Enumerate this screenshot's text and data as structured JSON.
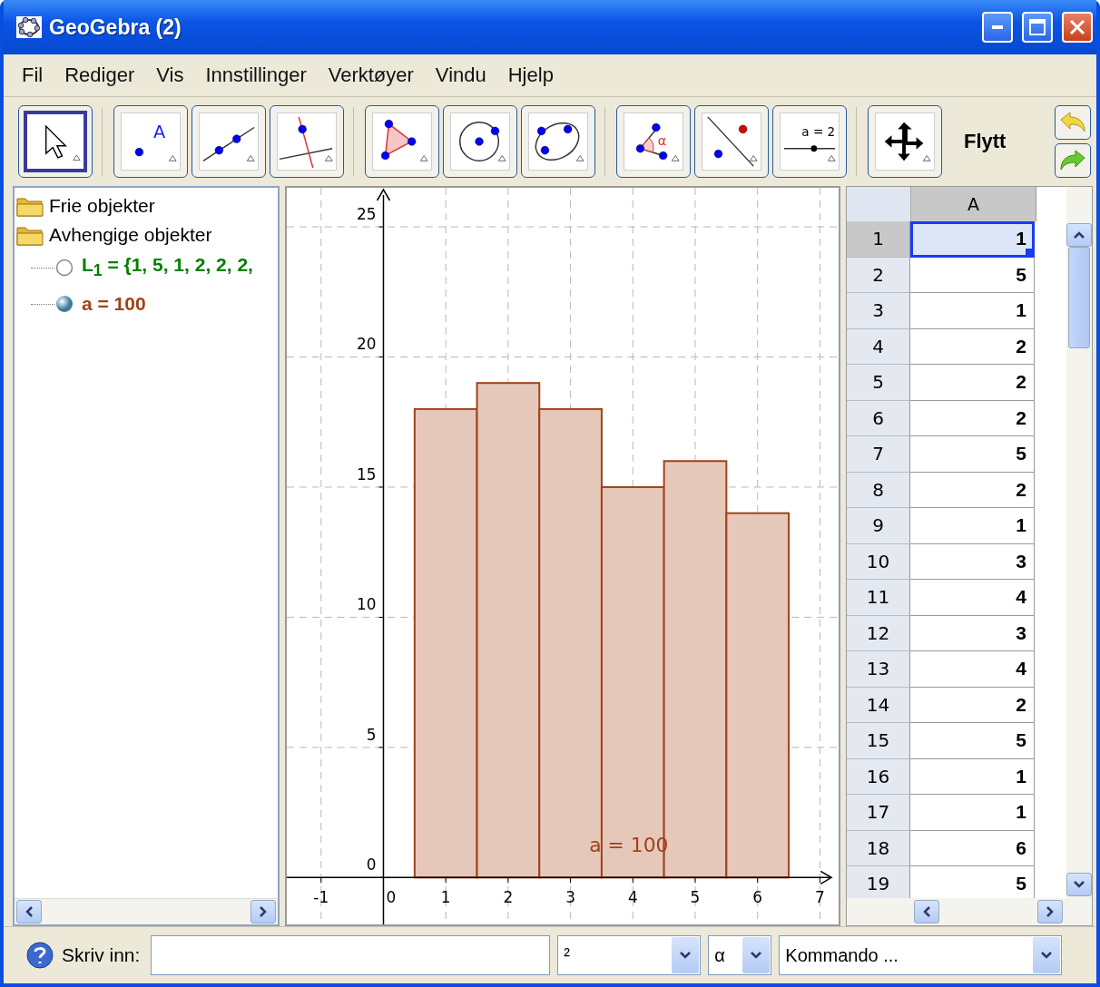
{
  "window": {
    "title": "GeoGebra (2)"
  },
  "menu": [
    "Fil",
    "Rediger",
    "Vis",
    "Innstillinger",
    "Verktøyer",
    "Vindu",
    "Hjelp"
  ],
  "toolbar": {
    "tools": [
      {
        "kind": "move",
        "selected": true
      },
      {
        "kind": "point",
        "selected": false,
        "label": "A"
      },
      {
        "kind": "line",
        "selected": false
      },
      {
        "kind": "perpendicular",
        "selected": false
      },
      {
        "kind": "polygon",
        "selected": false
      },
      {
        "kind": "circle",
        "selected": false
      },
      {
        "kind": "conic",
        "selected": false
      },
      {
        "kind": "angle",
        "selected": false,
        "label": "α"
      },
      {
        "kind": "reflect",
        "selected": false
      },
      {
        "kind": "slider",
        "selected": false,
        "label": "a = 2"
      },
      {
        "kind": "pan",
        "selected": false
      }
    ],
    "tool_name": "Flytt"
  },
  "algebra": {
    "folders": [
      {
        "label": "Frie objekter"
      },
      {
        "label": "Avhengige objekter",
        "children": [
          {
            "text": "L$_{1}$ = {1, 5, 1, 2, 2, 2,",
            "visible": false,
            "color": "#008000"
          },
          {
            "text": "a = 100",
            "visible": true,
            "color": "#a0421a"
          }
        ]
      }
    ]
  },
  "graphics": {
    "label": "a = 100",
    "chart_data": {
      "type": "bar",
      "grid": true,
      "x": [
        1,
        2,
        3,
        4,
        5,
        6
      ],
      "series": [
        {
          "color": "#e6c8bb",
          "values": [
            18,
            19,
            18,
            15,
            16,
            14
          ]
        }
      ],
      "xlim": [
        -1.55,
        7.3
      ],
      "ylim": [
        -1.8,
        26.5
      ],
      "xticks": [
        -1,
        0,
        1,
        2,
        3,
        4,
        5,
        6,
        7
      ],
      "yticks": [
        0,
        5,
        10,
        15,
        20,
        25
      ]
    }
  },
  "spreadsheet": {
    "column": "A",
    "rows": [
      {
        "row": "1",
        "value": "1",
        "selected": true
      },
      {
        "row": "2",
        "value": "5",
        "selected": false
      },
      {
        "row": "3",
        "value": "1",
        "selected": false
      },
      {
        "row": "4",
        "value": "2",
        "selected": false
      },
      {
        "row": "5",
        "value": "2",
        "selected": false
      },
      {
        "row": "6",
        "value": "2",
        "selected": false
      },
      {
        "row": "7",
        "value": "5",
        "selected": false
      },
      {
        "row": "8",
        "value": "2",
        "selected": false
      },
      {
        "row": "9",
        "value": "1",
        "selected": false
      },
      {
        "row": "10",
        "value": "3",
        "selected": false
      },
      {
        "row": "11",
        "value": "4",
        "selected": false
      },
      {
        "row": "12",
        "value": "3",
        "selected": false
      },
      {
        "row": "13",
        "value": "4",
        "selected": false
      },
      {
        "row": "14",
        "value": "2",
        "selected": false
      },
      {
        "row": "15",
        "value": "5",
        "selected": false
      },
      {
        "row": "16",
        "value": "1",
        "selected": false
      },
      {
        "row": "17",
        "value": "1",
        "selected": false
      },
      {
        "row": "18",
        "value": "6",
        "selected": false
      },
      {
        "row": "19",
        "value": "5",
        "selected": false
      }
    ]
  },
  "input_bar": {
    "label": "Skriv inn:",
    "dropdowns": [
      "²",
      "α",
      "Kommando ..."
    ]
  }
}
